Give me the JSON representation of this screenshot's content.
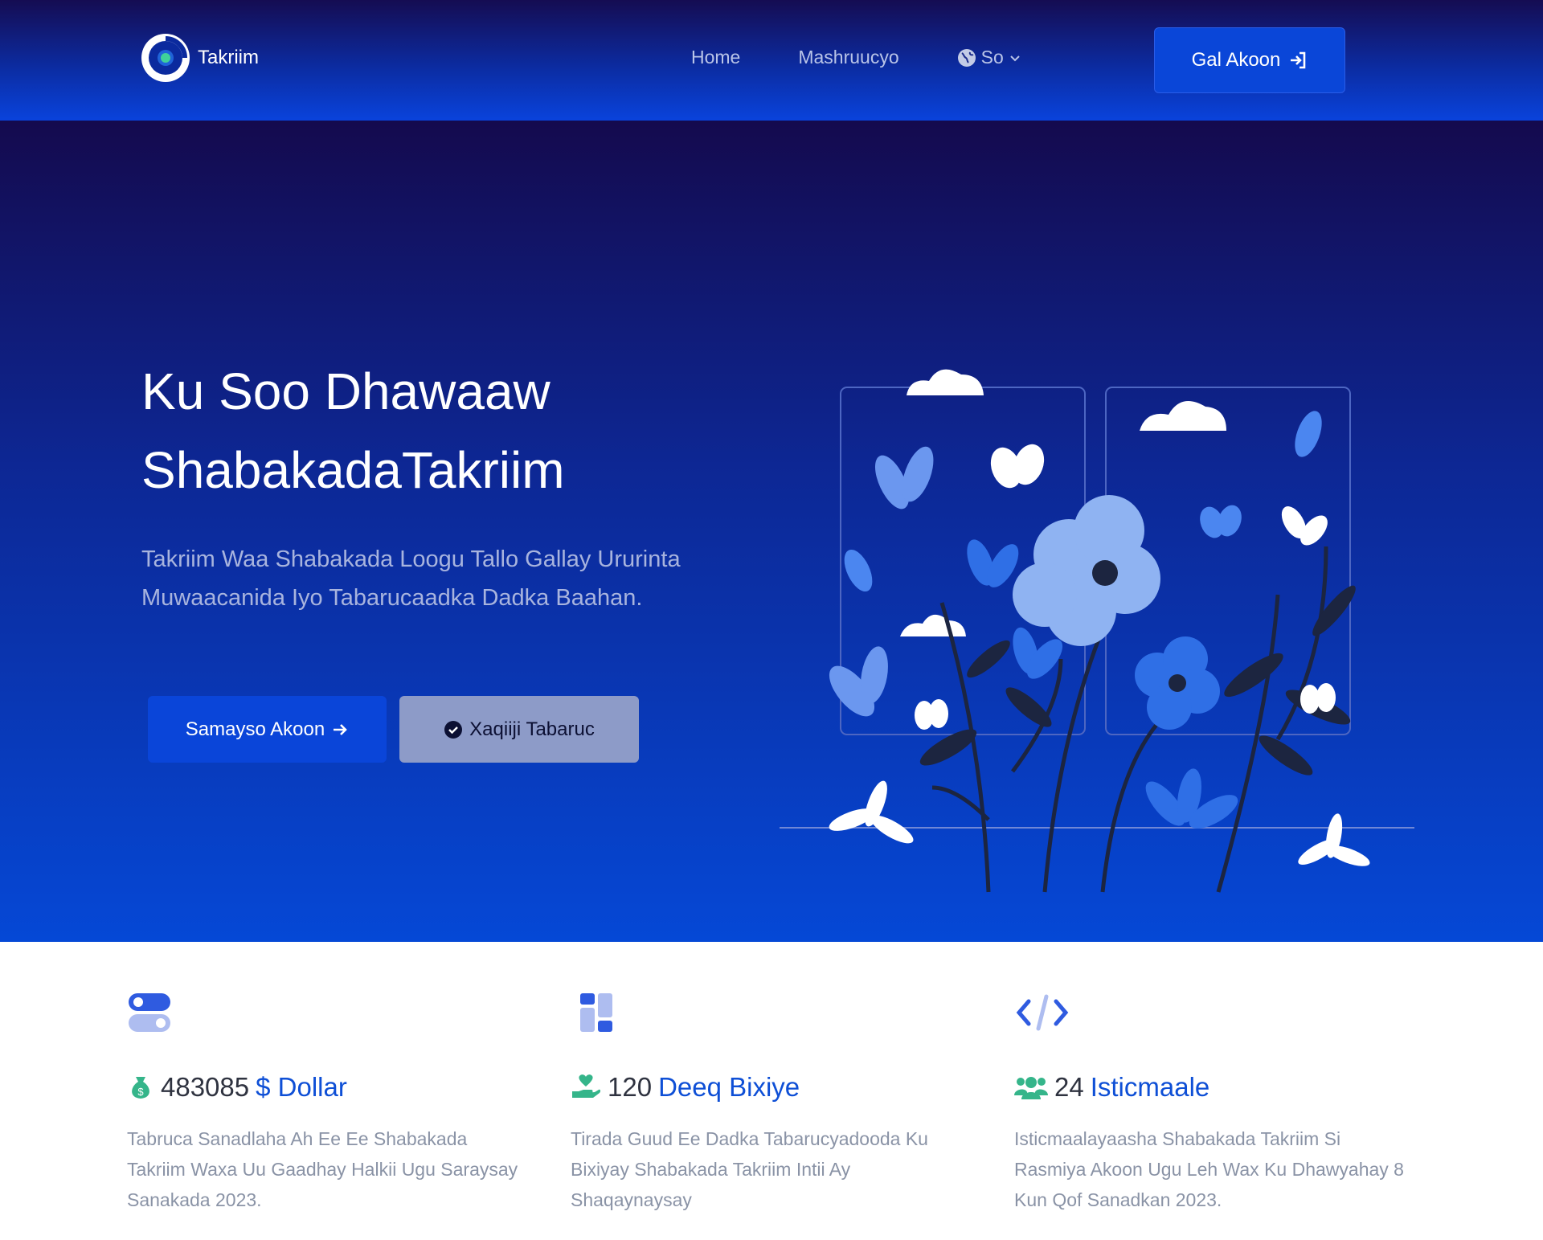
{
  "nav": {
    "brand": "Takriim",
    "links": [
      "Home",
      "Mashruucyo"
    ],
    "language": "So",
    "login_label": "Gal Akoon",
    "colors": {
      "bar_top": "#150c52",
      "bar_bottom": "#0a43dc",
      "button": "#0a46d8"
    }
  },
  "hero": {
    "title_line1": "Ku Soo Dhawaaw",
    "title_line2": "ShabakadaTakriim",
    "subtitle": "Takriim Waa Shabakada Loogu Tallo Gallay Ururinta Muwaacanida Iyo Tabarucaadka Dadka Baahan.",
    "primary_button": "Samayso Akoon",
    "secondary_button": "Xaqiiji Tabaruc",
    "colors": {
      "primary": "#0a45d9",
      "secondary": "#8d9bc8",
      "accent_flower": "#2f6fe6"
    }
  },
  "stats": [
    {
      "icon": "toggle-icon",
      "metric_icon": "money-bag-icon",
      "number": "483085",
      "unit": "$ Dollar",
      "description": "Tabruca Sanadlaha Ah Ee Ee Shabakada Takriim Waxa Uu Gaadhay Halkii Ugu Saraysay Sanakada 2023."
    },
    {
      "icon": "dashboard-icon",
      "metric_icon": "hand-holding-heart-icon",
      "number": "120",
      "unit": "Deeq Bixiye",
      "description": "Tirada Guud Ee Dadka Tabarucyadooda Ku Bixiyay Shabakada Takriim Intii Ay Shaqaynaysay"
    },
    {
      "icon": "code-icon",
      "metric_icon": "users-icon",
      "number": "24",
      "unit": "Isticmaale",
      "description": "Isticmaalayaasha Shabakada Takriim Si Rasmiya Akoon Ugu Leh Wax Ku Dhawyahay 8 Kun Qof Sanadkan 2023."
    }
  ]
}
